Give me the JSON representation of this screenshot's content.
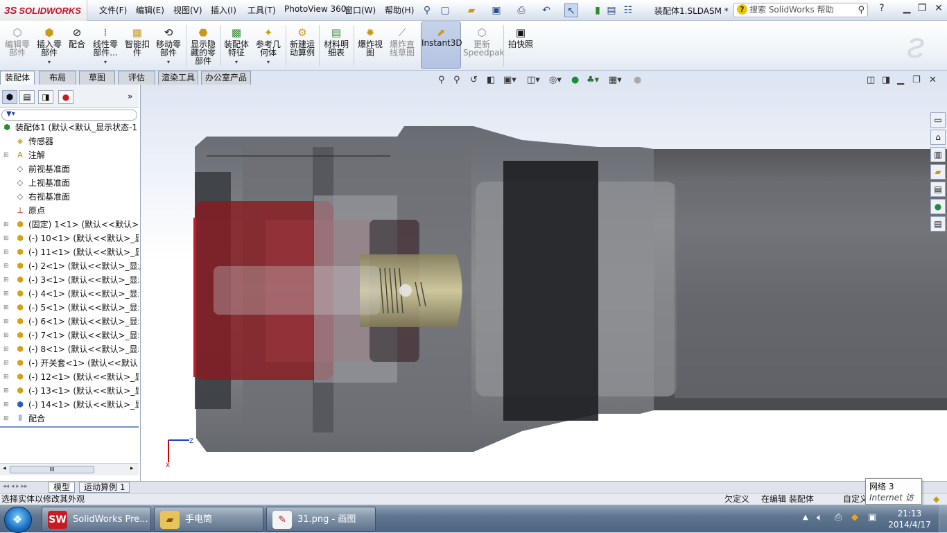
{
  "app": {
    "logo": "SOLIDWORKS",
    "logo_ds": "3S",
    "doc_title": "装配体1.SLDASM *",
    "search_placeholder": "搜索 SolidWorks 帮助"
  },
  "menus": [
    "文件(F)",
    "编辑(E)",
    "视图(V)",
    "插入(I)",
    "工具(T)",
    "PhotoView 360",
    "窗口(W)",
    "帮助(H)"
  ],
  "ribbon": [
    {
      "label": "编辑零部件",
      "icon": "edit-component-icon",
      "enabled": false
    },
    {
      "label": "插入零部件",
      "icon": "insert-component-icon",
      "enabled": true
    },
    {
      "label": "配合",
      "icon": "mate-icon",
      "enabled": true
    },
    {
      "label": "线性零部件...",
      "icon": "linear-pattern-icon",
      "enabled": true
    },
    {
      "label": "智能扣件",
      "icon": "smart-fastener-icon",
      "enabled": true
    },
    {
      "label": "移动零部件",
      "icon": "move-component-icon",
      "enabled": true
    },
    {
      "label": "显示隐藏的零部件",
      "icon": "show-hidden-icon",
      "enabled": true
    },
    {
      "label": "装配体特征",
      "icon": "assembly-feature-icon",
      "enabled": true
    },
    {
      "label": "参考几何体",
      "icon": "reference-geometry-icon",
      "enabled": true
    },
    {
      "label": "新建运动算例",
      "icon": "motion-study-icon",
      "enabled": true
    },
    {
      "label": "材料明细表",
      "icon": "bom-icon",
      "enabled": true
    },
    {
      "label": "爆炸视图",
      "icon": "explode-view-icon",
      "enabled": true
    },
    {
      "label": "爆炸直线草图",
      "icon": "explode-line-icon",
      "enabled": false
    },
    {
      "label": "Instant3D",
      "icon": "instant3d-icon",
      "enabled": true,
      "active": true
    },
    {
      "label": "更新Speedpak",
      "icon": "speedpak-icon",
      "enabled": false
    },
    {
      "label": "拍快照",
      "icon": "snapshot-icon",
      "enabled": true
    }
  ],
  "tabs": [
    "装配体",
    "布局",
    "草图",
    "评估",
    "渲染工具",
    "办公室产品"
  ],
  "tree": [
    {
      "label": "装配体1 (默认<默认_显示状态-1",
      "icon": "assembly-icon",
      "expand": false
    },
    {
      "label": "传感器",
      "icon": "sensor-icon",
      "expand": false
    },
    {
      "label": "注解",
      "icon": "annotation-icon",
      "expand": true
    },
    {
      "label": "前视基准面",
      "icon": "plane-icon",
      "expand": false
    },
    {
      "label": "上视基准面",
      "icon": "plane-icon",
      "expand": false
    },
    {
      "label": "右视基准面",
      "icon": "plane-icon",
      "expand": false
    },
    {
      "label": "原点",
      "icon": "origin-icon",
      "expand": false
    },
    {
      "label": "(固定) 1<1> (默认<<默认>_显",
      "icon": "part-icon",
      "expand": true
    },
    {
      "label": "(-) 10<1> (默认<<默认>_显示",
      "icon": "part-icon",
      "expand": true
    },
    {
      "label": "(-) 11<1> (默认<<默认>_显示",
      "icon": "part-icon",
      "expand": true
    },
    {
      "label": "(-) 2<1> (默认<<默认>_显示",
      "icon": "part-icon",
      "expand": true
    },
    {
      "label": "(-) 3<1> (默认<<默认>_显示",
      "icon": "part-icon",
      "expand": true
    },
    {
      "label": "(-) 4<1> (默认<<默认>_显示",
      "icon": "part-icon",
      "expand": true
    },
    {
      "label": "(-) 5<1> (默认<<默认>_显示",
      "icon": "part-icon",
      "expand": true
    },
    {
      "label": "(-) 6<1> (默认<<默认>_显示",
      "icon": "part-icon",
      "expand": true
    },
    {
      "label": "(-) 7<1> (默认<<默认>_显示",
      "icon": "part-icon",
      "expand": true
    },
    {
      "label": "(-) 8<1> (默认<<默认>_显示",
      "icon": "part-icon",
      "expand": true
    },
    {
      "label": "(-) 开关套<1> (默认<<默认>",
      "icon": "part-icon",
      "expand": true
    },
    {
      "label": "(-) 12<1> (默认<<默认>_显示",
      "icon": "part-icon",
      "expand": true
    },
    {
      "label": "(-) 13<1> (默认<<默认>_显示",
      "icon": "part-icon",
      "expand": true
    },
    {
      "label": "(-) 14<1> (默认<<默认>_显示",
      "icon": "part-blue-icon",
      "expand": true
    },
    {
      "label": "配合",
      "icon": "mates-folder-icon",
      "expand": true
    }
  ],
  "bottom_tabs": [
    "模型",
    "运动算例 1"
  ],
  "status": {
    "left": "选择实体以修改其外观",
    "custom": "欠定义",
    "editing": "在编辑 装配体",
    "customize": "自定义"
  },
  "tooltip": {
    "line1": "网络 3",
    "line2": "Internet 访问"
  },
  "taskbar": [
    {
      "label": "SolidWorks Pre...",
      "icon": "solidworks-icon"
    },
    {
      "label": "手电筒",
      "icon": "folder-icon"
    },
    {
      "label": "31.png - 画图",
      "icon": "paint-icon"
    }
  ],
  "clock": {
    "time": "21:13",
    "date": "2014/4/17"
  },
  "axes": {
    "x": "X",
    "z": "Z"
  },
  "colors": {
    "brand": "#c8102e",
    "selected_tab": "#f6f8fb",
    "taskbar": "#5f7690"
  }
}
